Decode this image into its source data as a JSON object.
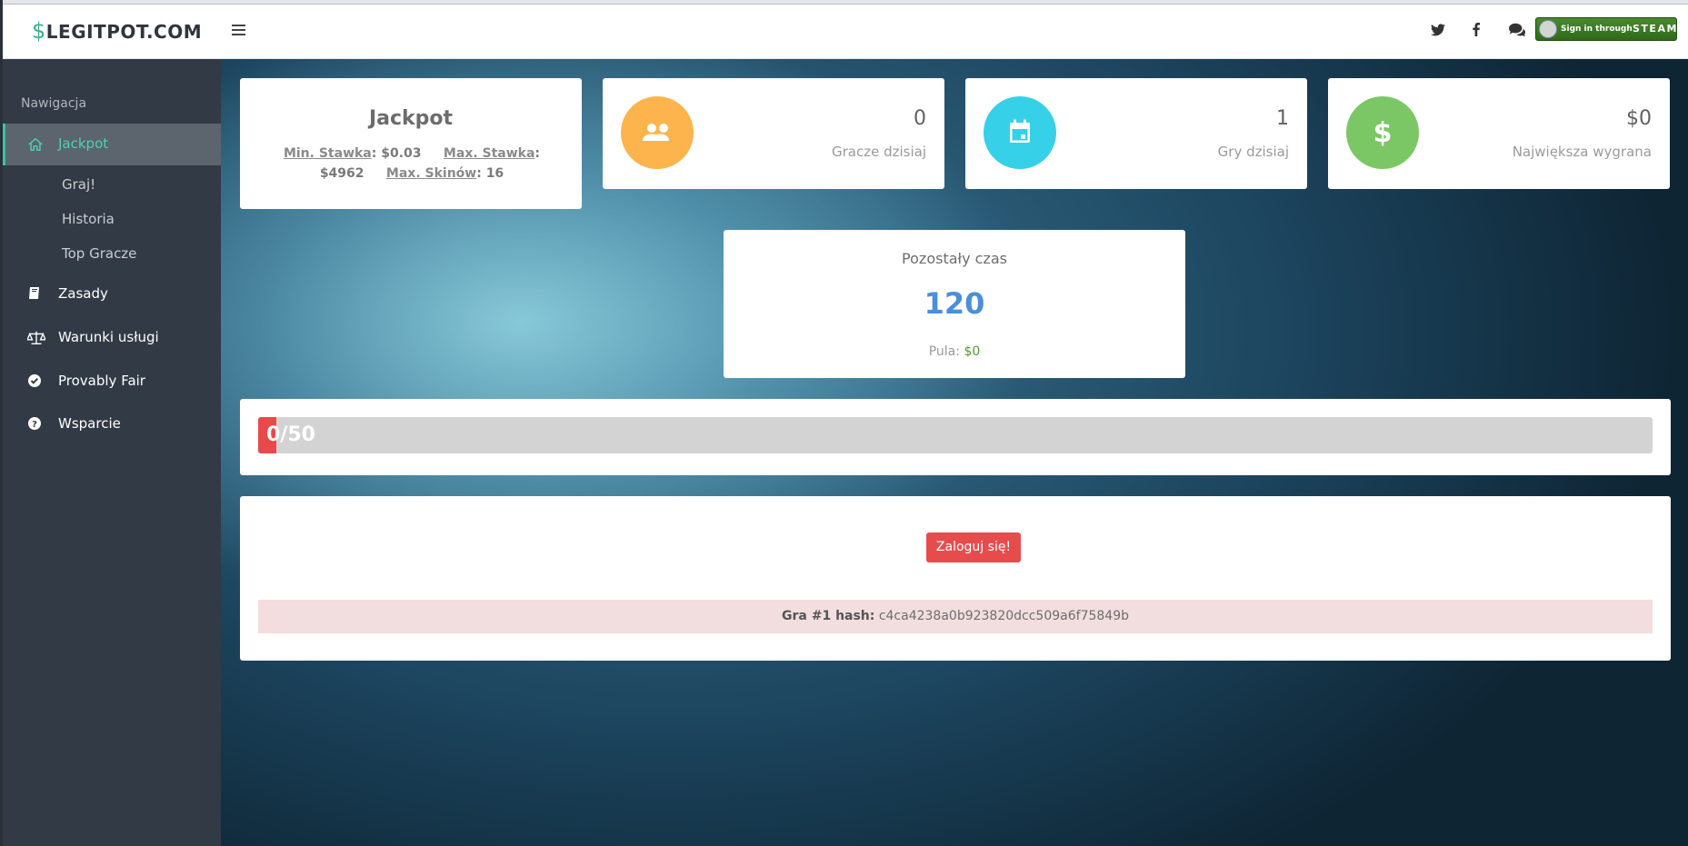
{
  "header": {
    "logo_symbol": "$",
    "logo_text": "LEGITPOT.COM",
    "steam_small": "Sign in through",
    "steam_big": "STEAM"
  },
  "sidebar": {
    "heading": "Nawigacja",
    "items": [
      {
        "label": "Jackpot",
        "icon": "home-icon",
        "active": true
      },
      {
        "label": "Graj!"
      },
      {
        "label": "Historia"
      },
      {
        "label": "Top Gracze"
      },
      {
        "label": "Zasady",
        "icon": "book-icon"
      },
      {
        "label": "Warunki usługi",
        "icon": "scale-icon"
      },
      {
        "label": "Provably Fair",
        "icon": "check-circle-icon"
      },
      {
        "label": "Wsparcie",
        "icon": "question-circle-icon"
      }
    ]
  },
  "jackpot": {
    "title": "Jackpot",
    "min_label": "Min. Stawka",
    "min_value": ": $0.03",
    "max_label": "Max. Stawka",
    "max_value": ": $4962",
    "skins_label": "Max. Skinów",
    "skins_value": ": 16"
  },
  "stats": [
    {
      "value": "0",
      "label": "Gracze dzisiaj",
      "icon": "users-icon",
      "color": "#fdb44d"
    },
    {
      "value": "1",
      "label": "Gry dzisiaj",
      "icon": "calendar-icon",
      "color": "#36d0e8"
    },
    {
      "value": "$0",
      "label": "Największa wygrana",
      "icon": "dollar-icon",
      "color": "#7cc765"
    }
  ],
  "timer": {
    "heading": "Pozostały czas",
    "value": "120",
    "pool_label": "Pula:",
    "pool_value": "$0"
  },
  "progress": {
    "text": "0/50",
    "fraction": 0.0,
    "color": "#e9494a"
  },
  "game": {
    "login_button": "Zaloguj się!",
    "hash_label": "Gra #1 hash:",
    "hash_value": "c4ca4238a0b923820dcc509a6f75849b"
  }
}
